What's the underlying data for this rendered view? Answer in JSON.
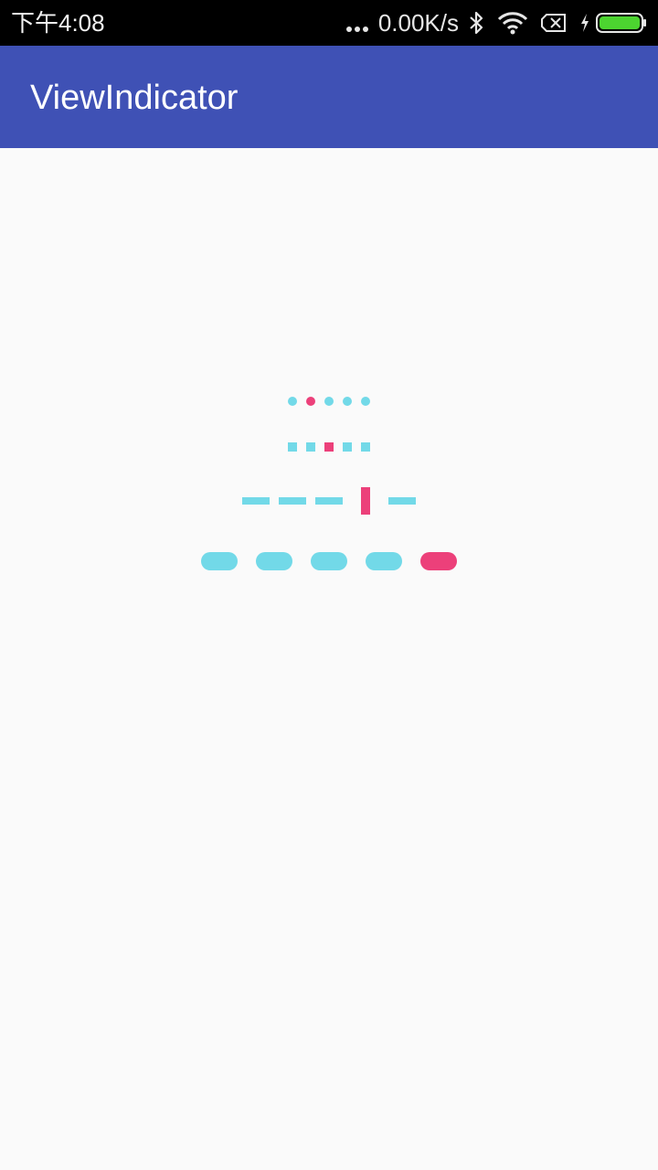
{
  "status_bar": {
    "time": "下午4:08",
    "net_speed": "0.00K/s",
    "icons": [
      "more-icon",
      "bluetooth-icon",
      "wifi-icon",
      "no-sim-icon",
      "charging-icon",
      "battery-icon"
    ]
  },
  "app_bar": {
    "title": "ViewIndicator"
  },
  "colors": {
    "status_bar": "#000000",
    "app_bar": "#3f51b5",
    "background": "#fafafa",
    "indicator_normal": "#72d9e8",
    "indicator_selected": "#ec407a",
    "battery_fill": "#4cd430"
  },
  "indicators": [
    {
      "style": "dot",
      "count": 5,
      "selected_index": 1
    },
    {
      "style": "square",
      "count": 5,
      "selected_index": 2
    },
    {
      "style": "dash",
      "count": 5,
      "selected_index": 3
    },
    {
      "style": "pill",
      "count": 5,
      "selected_index": 4
    }
  ]
}
